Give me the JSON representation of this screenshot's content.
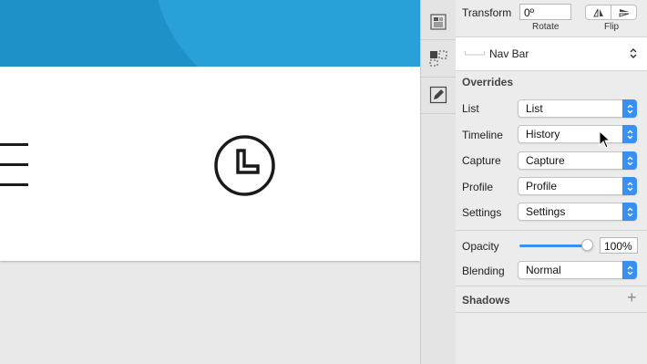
{
  "inspector": {
    "transform": {
      "label": "Transform",
      "rotate_value": "0º",
      "rotate_label": "Rotate",
      "flip_label": "Flip"
    },
    "symbol": {
      "name": "Nav Bar"
    },
    "overrides": {
      "title": "Overrides",
      "rows": [
        {
          "label": "List",
          "value": "List"
        },
        {
          "label": "Timeline",
          "value": "History"
        },
        {
          "label": "Capture",
          "value": "Capture"
        },
        {
          "label": "Profile",
          "value": "Profile"
        },
        {
          "label": "Settings",
          "value": "Settings"
        }
      ]
    },
    "opacity": {
      "label": "Opacity",
      "value": "100%",
      "level": 1.0
    },
    "blending": {
      "label": "Blending",
      "value": "Normal"
    },
    "shadows": {
      "title": "Shadows",
      "add_symbol": "+"
    }
  },
  "colors": {
    "accent": "#3a8ff3",
    "hero": "#1e91c9",
    "icon": "#1a1a1a"
  },
  "icons": [
    "hamburger-menu-icon",
    "clock-icon",
    "inspector-icon",
    "layout-icon",
    "edit-icon",
    "flip-horizontal-icon",
    "flip-vertical-icon",
    "symbol-icon",
    "chevron-updown-icon",
    "cursor-icon"
  ]
}
